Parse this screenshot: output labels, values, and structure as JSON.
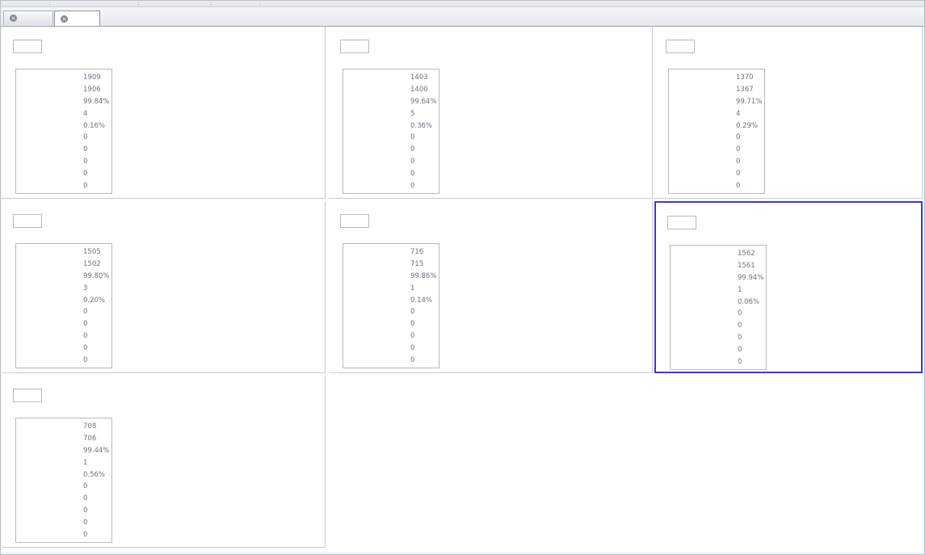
{
  "tabs": [
    {
      "label": "",
      "active": false
    },
    {
      "label": "",
      "active": true
    }
  ],
  "panels": [
    {
      "title": "",
      "selected": false,
      "rows": [
        {
          "label": "",
          "value": "1909"
        },
        {
          "label": "",
          "value": "1906"
        },
        {
          "label": "",
          "value": "99.84%"
        },
        {
          "label": "",
          "value": "4"
        },
        {
          "label": "",
          "value": "0.16%"
        },
        {
          "label": "",
          "value": "0"
        },
        {
          "label": "",
          "value": "0"
        },
        {
          "label": "",
          "value": "0"
        },
        {
          "label": "",
          "value": "0"
        },
        {
          "label": "",
          "value": "0"
        }
      ]
    },
    {
      "title": "",
      "selected": false,
      "rows": [
        {
          "label": "",
          "value": "1403"
        },
        {
          "label": "",
          "value": "1400"
        },
        {
          "label": "",
          "value": "99.64%"
        },
        {
          "label": "",
          "value": "5"
        },
        {
          "label": "",
          "value": "0.36%"
        },
        {
          "label": "",
          "value": "0"
        },
        {
          "label": "",
          "value": "0"
        },
        {
          "label": "",
          "value": "0"
        },
        {
          "label": "",
          "value": "0"
        },
        {
          "label": "",
          "value": "0"
        }
      ]
    },
    {
      "title": "",
      "selected": false,
      "rows": [
        {
          "label": "",
          "value": "1370"
        },
        {
          "label": "",
          "value": "1367"
        },
        {
          "label": "",
          "value": "99.71%"
        },
        {
          "label": "",
          "value": "4"
        },
        {
          "label": "",
          "value": "0.29%"
        },
        {
          "label": "",
          "value": "0"
        },
        {
          "label": "",
          "value": "0"
        },
        {
          "label": "",
          "value": "0"
        },
        {
          "label": "",
          "value": "0"
        },
        {
          "label": "",
          "value": "0"
        }
      ]
    },
    {
      "title": "",
      "selected": false,
      "rows": [
        {
          "label": "",
          "value": "1505"
        },
        {
          "label": "",
          "value": "1502"
        },
        {
          "label": "",
          "value": "99.80%"
        },
        {
          "label": "",
          "value": "3"
        },
        {
          "label": "",
          "value": "0.20%"
        },
        {
          "label": "",
          "value": "0"
        },
        {
          "label": "",
          "value": "0"
        },
        {
          "label": "",
          "value": "0"
        },
        {
          "label": "",
          "value": "0"
        },
        {
          "label": "",
          "value": "0"
        }
      ]
    },
    {
      "title": "",
      "selected": false,
      "rows": [
        {
          "label": "",
          "value": "716"
        },
        {
          "label": "",
          "value": "715"
        },
        {
          "label": "",
          "value": "99.86%"
        },
        {
          "label": "",
          "value": "1"
        },
        {
          "label": "",
          "value": "0.14%"
        },
        {
          "label": "",
          "value": "0"
        },
        {
          "label": "",
          "value": "0"
        },
        {
          "label": "",
          "value": "0"
        },
        {
          "label": "",
          "value": "0"
        },
        {
          "label": "",
          "value": "0"
        }
      ]
    },
    {
      "title": "",
      "selected": true,
      "rows": [
        {
          "label": "",
          "value": "1562"
        },
        {
          "label": "",
          "value": "1561"
        },
        {
          "label": "",
          "value": "99.94%"
        },
        {
          "label": "",
          "value": "1"
        },
        {
          "label": "",
          "value": "0.06%"
        },
        {
          "label": "",
          "value": "0"
        },
        {
          "label": "",
          "value": "0"
        },
        {
          "label": "",
          "value": "0"
        },
        {
          "label": "",
          "value": "0"
        },
        {
          "label": "",
          "value": "0"
        }
      ]
    },
    {
      "title": "",
      "selected": false,
      "rows": [
        {
          "label": "",
          "value": "708"
        },
        {
          "label": "",
          "value": "706"
        },
        {
          "label": "",
          "value": "99.44%"
        },
        {
          "label": "",
          "value": "1"
        },
        {
          "label": "",
          "value": "0.56%"
        },
        {
          "label": "",
          "value": "0"
        },
        {
          "label": "",
          "value": "0"
        },
        {
          "label": "",
          "value": "0"
        },
        {
          "label": "",
          "value": "0"
        },
        {
          "label": "",
          "value": "0"
        }
      ]
    }
  ],
  "icons": {
    "tab_close": "close-circle-icon"
  },
  "colors": {
    "selected_border": "#3a3ad6",
    "tab_active_bg": "#ffffff"
  }
}
